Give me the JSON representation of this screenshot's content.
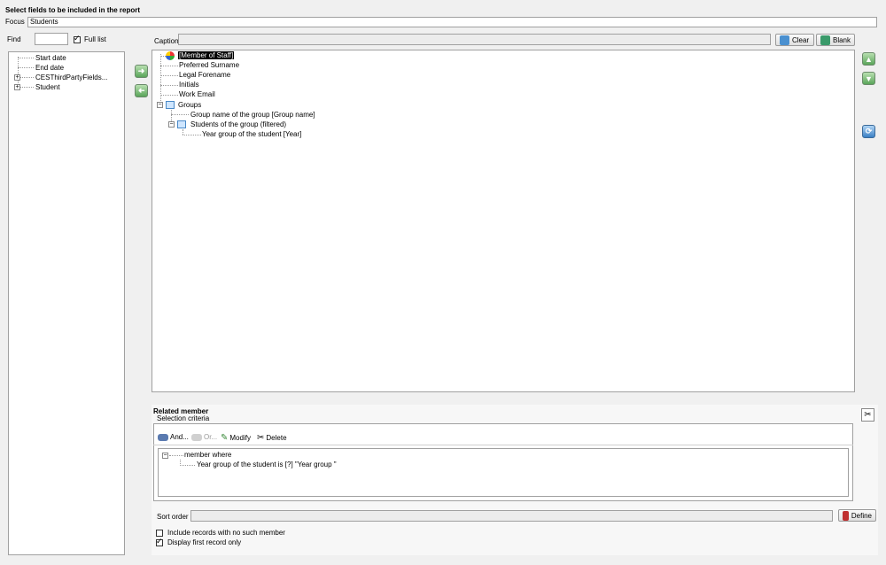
{
  "header": {
    "title": "Select fields to be included in the report"
  },
  "focus": {
    "label": "Focus",
    "value": "Students"
  },
  "find": {
    "label": "Find",
    "value": "",
    "full_list_label": "Full list"
  },
  "left_tree": {
    "items": [
      "Start date",
      "End date",
      "CESThirdPartyFields...",
      "Student"
    ]
  },
  "caption": {
    "label": "Caption",
    "value": "",
    "clear_label": "Clear",
    "blank_label": "Blank"
  },
  "report_tree": {
    "root": "[Member of Staff]",
    "items": [
      "Preferred Surname",
      "Legal Forename",
      "Initials",
      "Work Email"
    ],
    "groups_label": "Groups",
    "group_name": "Group name of the group [Group name]",
    "students_filtered": "Students of the group (filtered)",
    "year_group": "Year group of the student [Year]"
  },
  "related": {
    "title": "Related member",
    "selection_criteria": "Selection criteria",
    "toolbar": {
      "and": "And...",
      "or": "Or...",
      "modify": "Modify",
      "delete": "Delete"
    },
    "criteria_root": "member where",
    "criteria_item": "Year group of the student is  [?] \"Year group \"",
    "sort_label": "Sort order",
    "sort_value": "",
    "define_label": "Define",
    "include_no_member": "Include records with no such member",
    "display_first": "Display first record only"
  }
}
